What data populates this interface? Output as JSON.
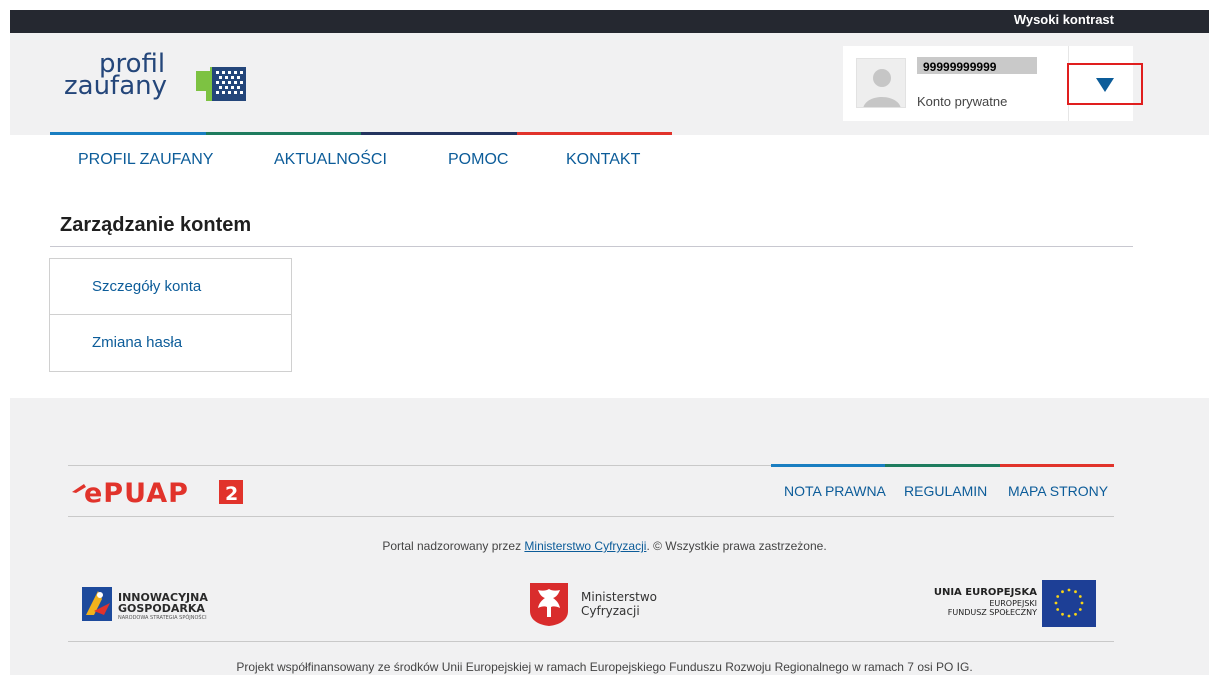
{
  "topbar": {
    "contrast_label": "Wysoki kontrast"
  },
  "logo": {
    "line1": "profil",
    "line2": "zaufany"
  },
  "user": {
    "id": "99999999999",
    "account_type": "Konto prywatne"
  },
  "nav": {
    "items": [
      {
        "label": "PROFIL ZAUFANY"
      },
      {
        "label": "AKTUALNOŚCI"
      },
      {
        "label": "POMOC"
      },
      {
        "label": "KONTAKT"
      }
    ]
  },
  "page": {
    "title": "Zarządzanie kontem"
  },
  "side_menu": {
    "items": [
      {
        "label": "Szczegóły konta"
      },
      {
        "label": "Zmiana hasła"
      }
    ]
  },
  "footer": {
    "links": [
      {
        "label": "NOTA PRAWNA"
      },
      {
        "label": "REGULAMIN"
      },
      {
        "label": "MAPA STRONY"
      }
    ],
    "supervision_prefix": "Portal nadzorowany przez",
    "supervision_link": "Ministerstwo Cyfryzacji",
    "supervision_suffix": ". © Wszystkie prawa zastrzeżone.",
    "ig_line1": "INNOWACYJNA",
    "ig_line2": "GOSPODARKA",
    "ig_line3": "NARODOWA STRATEGIA SPÓJNOŚCI",
    "mc_line1": "Ministerstwo",
    "mc_line2": "Cyfryzacji",
    "eu_line1": "UNIA EUROPEJSKA",
    "eu_line2": "EUROPEJSKI",
    "eu_line3": "FUNDUSZ SPOŁECZNY",
    "project_note": "Projekt współfinansowany ze środków Unii Europejskiej w ramach Europejskiego Funduszu Rozwoju Regionalnego w ramach 7 osi PO IG."
  },
  "colors": {
    "stripe": [
      "#1a7ec1",
      "#1e7c5e",
      "#24345f",
      "#e1332b"
    ],
    "link": "#0c5c99",
    "dropdown_highlight": "#e01e1e"
  }
}
